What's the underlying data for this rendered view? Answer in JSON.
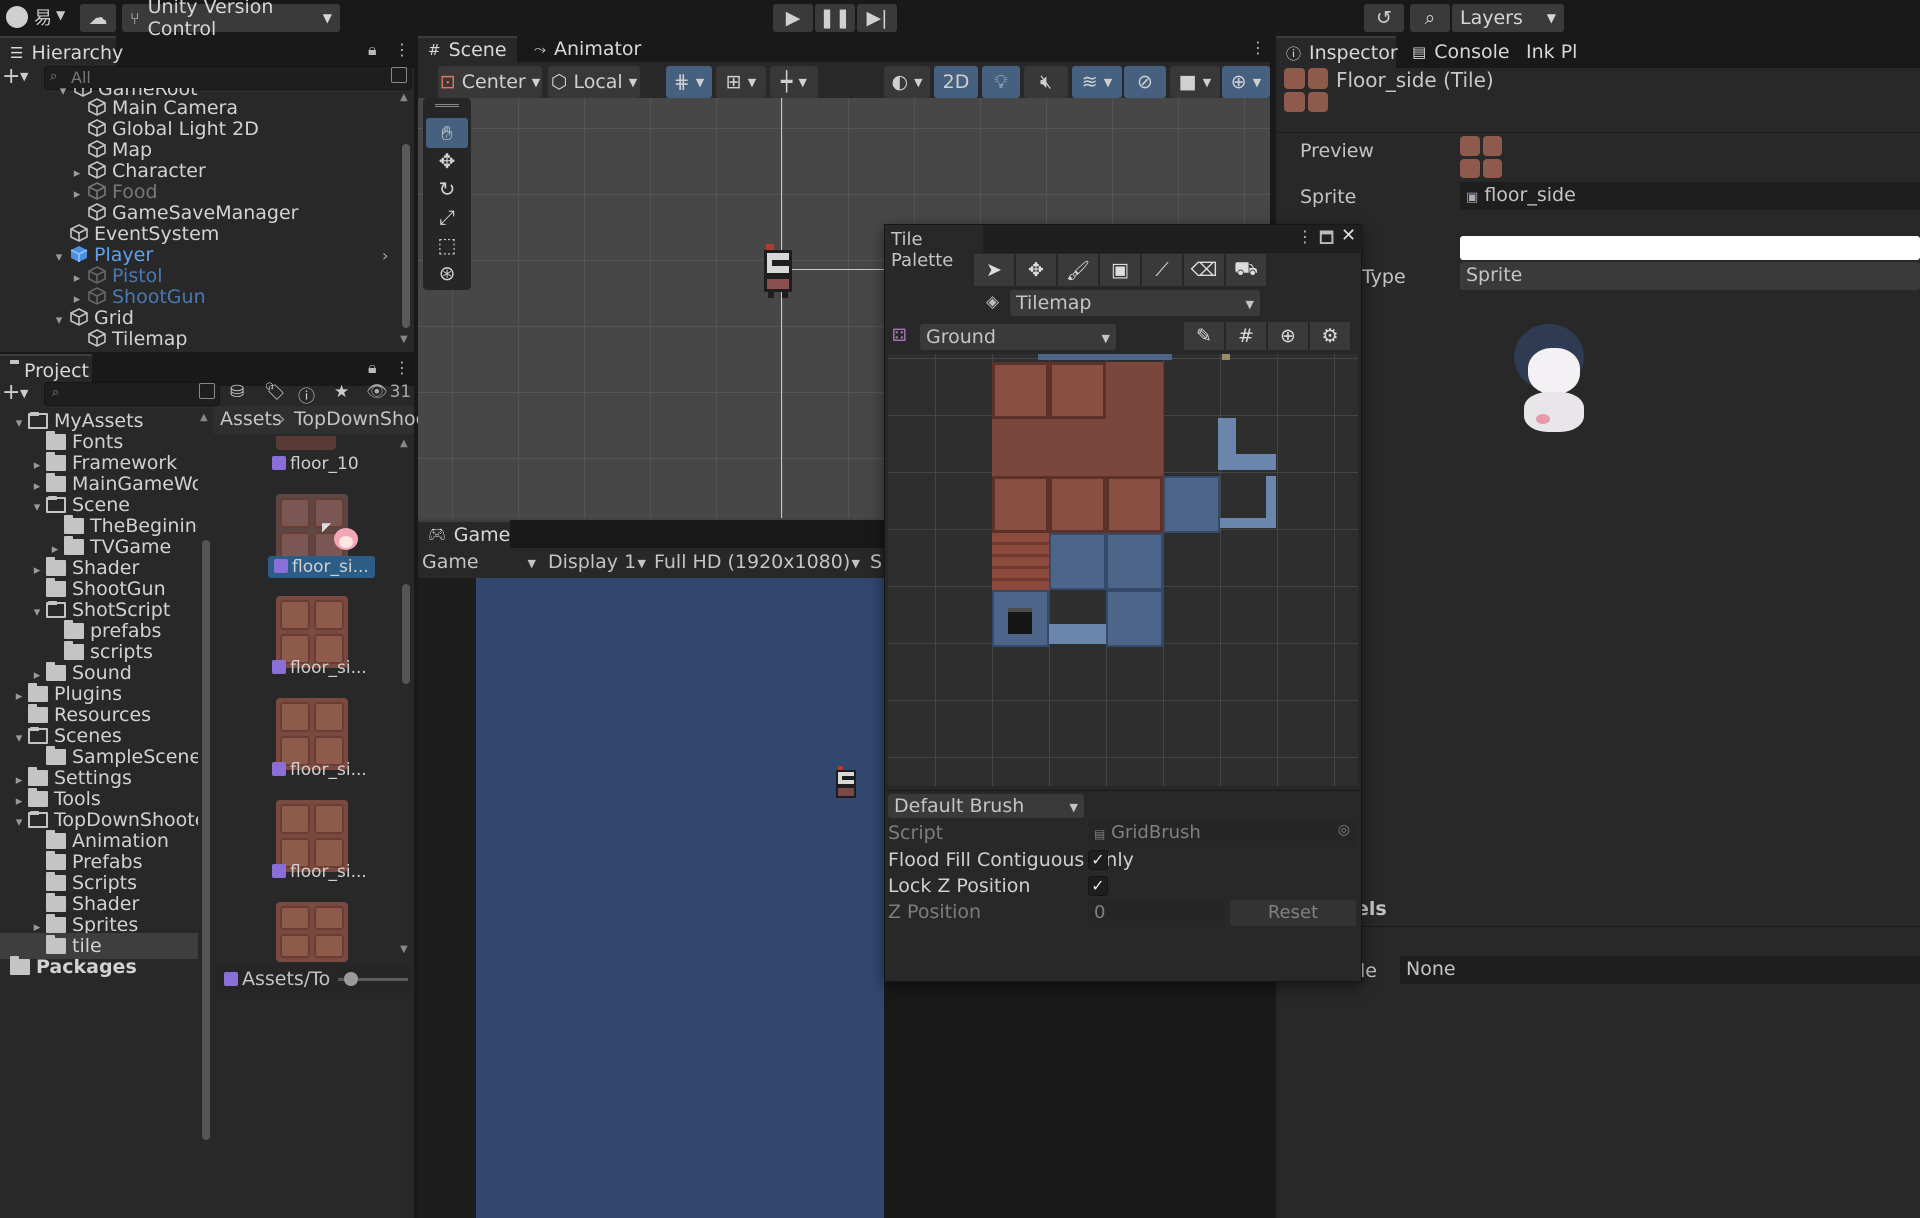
{
  "toolbar": {
    "account_icon": "account-icon",
    "cloud_icon": "cloud-icon",
    "app_glyph": "易",
    "version_control_label": "Unity Version Control",
    "play_icon": "play-icon",
    "pause_icon": "pause-icon",
    "step_icon": "step-icon",
    "history_icon": "history-icon",
    "search_icon": "search-icon",
    "layers_label": "Layers"
  },
  "hierarchy": {
    "tab_label": "Hierarchy",
    "search_placeholder": "All",
    "items": [
      {
        "label": "GameRoot"
      },
      {
        "label": "Main Camera"
      },
      {
        "label": "Global Light 2D"
      },
      {
        "label": "Map"
      },
      {
        "label": "Character"
      },
      {
        "label": "Food"
      },
      {
        "label": "GameSaveManager"
      },
      {
        "label": "EventSystem"
      },
      {
        "label": "Player"
      },
      {
        "label": "Pistol"
      },
      {
        "label": "ShootGun"
      },
      {
        "label": "Grid"
      },
      {
        "label": "Tilemap"
      }
    ]
  },
  "project": {
    "tab_label": "Project",
    "hidden_count": "31",
    "folders": [
      {
        "label": "MyAssets"
      },
      {
        "label": "Fonts"
      },
      {
        "label": "Framework"
      },
      {
        "label": "MainGameWorld"
      },
      {
        "label": "Scene"
      },
      {
        "label": "TheBeginingS"
      },
      {
        "label": "TVGame"
      },
      {
        "label": "Shader"
      },
      {
        "label": "ShootGun"
      },
      {
        "label": "ShotScript"
      },
      {
        "label": "prefabs"
      },
      {
        "label": "scripts"
      },
      {
        "label": "Sound"
      },
      {
        "label": "Plugins"
      },
      {
        "label": "Resources"
      },
      {
        "label": "Scenes"
      },
      {
        "label": "SampleScene"
      },
      {
        "label": "Settings"
      },
      {
        "label": "Tools"
      },
      {
        "label": "TopDownShooter"
      },
      {
        "label": "Animation"
      },
      {
        "label": "Prefabs"
      },
      {
        "label": "Scripts"
      },
      {
        "label": "Shader"
      },
      {
        "label": "Sprites"
      },
      {
        "label": "tile"
      },
      {
        "label": "Packages"
      }
    ],
    "breadcrumb": [
      "Assets",
      "TopDownShoote"
    ],
    "assets": [
      {
        "label": "floor_10"
      },
      {
        "label": "floor_si..."
      },
      {
        "label": "floor_si..."
      },
      {
        "label": "floor_si..."
      },
      {
        "label": "floor_si..."
      }
    ],
    "footer_path": "Assets/To"
  },
  "scene": {
    "tabs": [
      "Scene",
      "Animator"
    ],
    "pivot_label": "Center",
    "space_label": "Local",
    "mode_2d_label": "2D"
  },
  "game": {
    "tab_label": "Game",
    "view_label": "Game",
    "display_label": "Display 1",
    "resolution_label": "Full HD (1920x1080)",
    "scale_label": "S"
  },
  "tile_palette": {
    "title": "Tile Palette",
    "target_label": "Tilemap",
    "palette_label": "Ground",
    "brush_label": "Default Brush",
    "script_label": "Script",
    "script_value": "GridBrush",
    "flood_fill_label": "Flood Fill Contiguous Only",
    "flood_fill_checked": "✓",
    "lock_z_label": "Lock Z Position",
    "lock_z_checked": "✓",
    "z_position_label": "Z Position",
    "z_position_value": "0",
    "reset_label": "Reset"
  },
  "inspector": {
    "tabs": [
      "Inspector",
      "Console",
      "Ink Pl"
    ],
    "object_title": "Floor_side (Tile)",
    "preview_label": "Preview",
    "sprite_label": "Sprite",
    "sprite_value": "floor_side",
    "type_label": "Type",
    "type_value": "Sprite",
    "section_label": "els",
    "bottom_label": "le",
    "bottom_value": "None"
  },
  "colors": {
    "accent_blue": "#2d5b9e",
    "selection": "#2c5d87",
    "panel": "#282828",
    "game_bg": "#31476e"
  }
}
